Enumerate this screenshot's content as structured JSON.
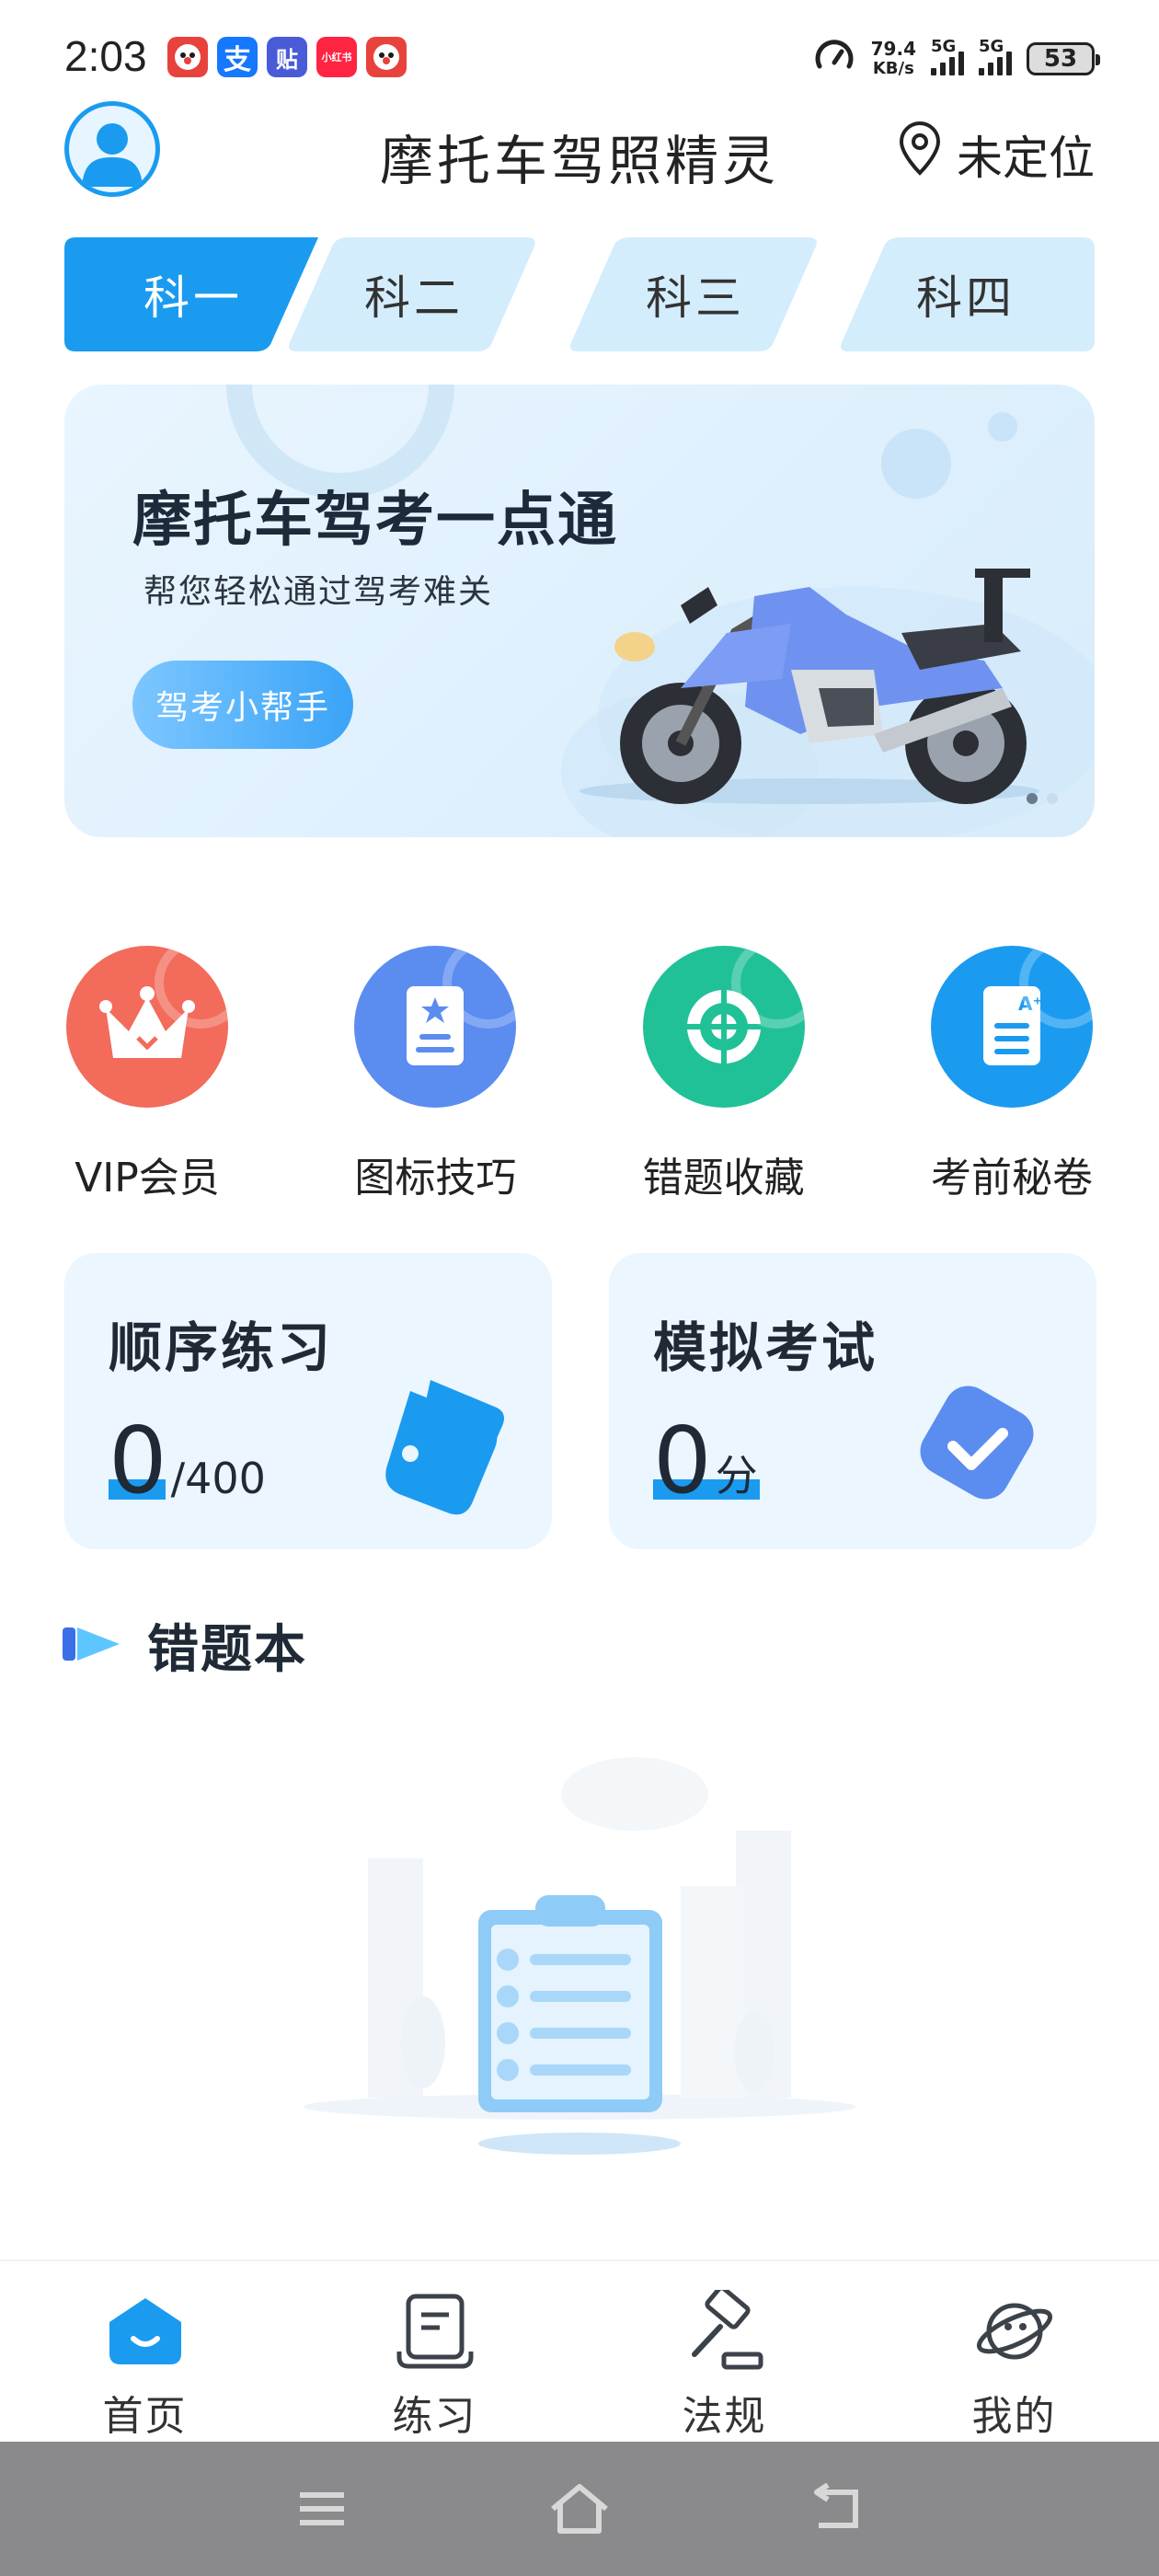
{
  "status_bar": {
    "time": "2:03",
    "notification_apps": [
      {
        "icon": "app-icon-clown",
        "text": "",
        "color": "#e8423c"
      },
      {
        "icon": "alipay-icon",
        "text": "支",
        "color": "#1677ff"
      },
      {
        "icon": "tieba-icon",
        "text": "贴",
        "color": "#4a5bd8"
      },
      {
        "icon": "xiaohongshu-icon",
        "text": "小红书",
        "color": "#ff2442"
      },
      {
        "icon": "app-icon-clown",
        "text": "",
        "color": "#e8423c"
      }
    ],
    "net_speed_value": "79.4",
    "net_speed_unit": "KB/s",
    "signal1_label": "5G",
    "signal2_label": "5G",
    "battery": "53"
  },
  "header": {
    "title": "摩托车驾照精灵",
    "location": "未定位"
  },
  "tabs": [
    {
      "label": "科一",
      "active": true
    },
    {
      "label": "科二",
      "active": false
    },
    {
      "label": "科三",
      "active": false
    },
    {
      "label": "科四",
      "active": false
    }
  ],
  "banner": {
    "title": "摩托车驾考一点通",
    "subtitle": "帮您轻松通过驾考难关",
    "button": "驾考小帮手"
  },
  "quick_actions": [
    {
      "label": "VIP会员",
      "icon": "crown-icon",
      "color": "#f26b5b"
    },
    {
      "label": "图标技巧",
      "icon": "book-star-icon",
      "color": "#5b8cf0"
    },
    {
      "label": "错题收藏",
      "icon": "target-icon",
      "color": "#21c197"
    },
    {
      "label": "考前秘卷",
      "icon": "exam-paper-icon",
      "color": "#1a9bf0"
    }
  ],
  "cards": {
    "practice": {
      "title": "顺序练习",
      "value": "0",
      "unit": "/400"
    },
    "exam": {
      "title": "模拟考试",
      "value": "0",
      "unit": "分"
    }
  },
  "wrong_book": {
    "title": "错题本"
  },
  "bottom_nav": [
    {
      "label": "首页",
      "icon": "home-icon",
      "active": true
    },
    {
      "label": "练习",
      "icon": "practice-icon",
      "active": false
    },
    {
      "label": "法规",
      "icon": "gavel-icon",
      "active": false
    },
    {
      "label": "我的",
      "icon": "planet-icon",
      "active": false
    }
  ],
  "colors": {
    "accent": "#1a9bf0",
    "tab_inactive": "#d4edfd",
    "card_bg": "#ebf6fe"
  }
}
